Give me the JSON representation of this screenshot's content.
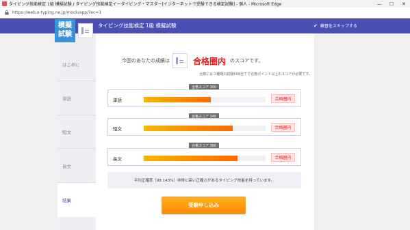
{
  "window": {
    "title": "タイピング技能検定 1級 模擬試験 / タイピング技能検定イータイピング・マスター[インターネットで受験できる検定試験] - 個人 - Microsoft Edge",
    "minimize": "—",
    "maximize": "☐",
    "close": "✕"
  },
  "address": {
    "url": "https://web.e-typing.ne.jp/mock/app/?ec=1"
  },
  "header": {
    "logo_line1": "模擬",
    "logo_line2": "試験",
    "title": "タイピング技能検定 1級 模擬試験",
    "skip_label": "練習をスキップする"
  },
  "nav": {
    "items": [
      {
        "label": "はじめに"
      },
      {
        "label": "単語"
      },
      {
        "label": "短文"
      },
      {
        "label": "長文"
      },
      {
        "label": "結果"
      }
    ]
  },
  "result": {
    "prefix": "今回のあなたの成績は",
    "outcome": "合格圏内",
    "suffix": "のスコアです。",
    "note": "合格には３種類の試験科目全てで合格ポイント以上のスコアが必要です。"
  },
  "scores": [
    {
      "label": "単語",
      "tip": "合格スコア 300",
      "badge": "合格圏内",
      "fill": 0.55
    },
    {
      "label": "短文",
      "tip": "合格スコア 340",
      "badge": "合格圏内",
      "fill": 0.73
    },
    {
      "label": "長文",
      "tip": "合格スコア 360",
      "badge": "合格圏内",
      "fill": 0.77
    }
  ],
  "accuracy": "平均正確率［98.143%］非常に高い正確さがあるタイピング技能を持っています。",
  "apply_button": "受験申し込み",
  "colors": {
    "header": "#4b4fb4",
    "accent": "#e02020",
    "button": "#ff9a00"
  }
}
